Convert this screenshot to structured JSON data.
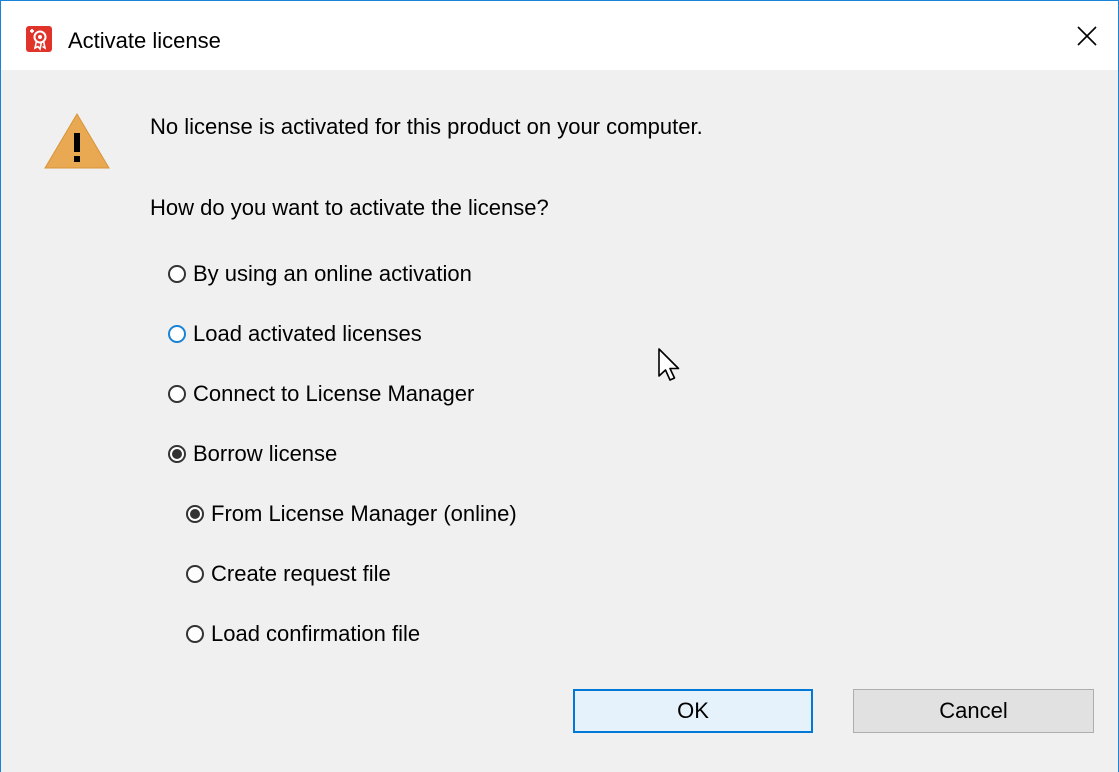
{
  "window": {
    "title": "Activate license",
    "app_icon": "ribbon-badge-icon",
    "close_icon": "close-icon",
    "accent_color": "#1883d7"
  },
  "dialog": {
    "warning_icon": "warning-icon",
    "message": "No license is activated for this product on your computer.",
    "question": "How do you want to activate the license?",
    "options": [
      {
        "label": "By using an online activation",
        "selected": false
      },
      {
        "label": "Load activated licenses",
        "selected": false,
        "focused": true
      },
      {
        "label": "Connect to License Manager",
        "selected": false
      },
      {
        "label": "Borrow license",
        "selected": true
      }
    ],
    "sub_options": [
      {
        "label": "From License Manager (online)",
        "selected": true
      },
      {
        "label": "Create request file",
        "selected": false
      },
      {
        "label": "Load confirmation file",
        "selected": false
      }
    ]
  },
  "buttons": {
    "ok_label": "OK",
    "cancel_label": "Cancel"
  }
}
